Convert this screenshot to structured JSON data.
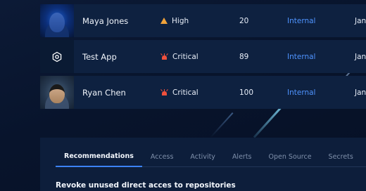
{
  "rows": [
    {
      "name": "Maya Jones",
      "severity": "High",
      "count": "20",
      "scope": "Internal",
      "date": "Jan",
      "thumb": "avatar-photo"
    },
    {
      "name": "Test App",
      "severity": "Critical",
      "count": "89",
      "scope": "Internal",
      "date": "Jan",
      "thumb": "hexagon-app-icon"
    },
    {
      "name": "Ryan Chen",
      "severity": "Critical",
      "count": "100",
      "scope": "Internal",
      "date": "Jan",
      "thumb": "avatar-photo"
    }
  ],
  "colors": {
    "high": "#f1a33a",
    "critical": "#f0503c",
    "link": "#4f94ff",
    "accent": "#3b82f6"
  },
  "tabs": [
    {
      "label": "Recommendations",
      "active": true
    },
    {
      "label": "Access",
      "active": false
    },
    {
      "label": "Activity",
      "active": false
    },
    {
      "label": "Alerts",
      "active": false
    },
    {
      "label": "Open Source",
      "active": false
    },
    {
      "label": "Secrets",
      "active": false
    }
  ],
  "recommendation": {
    "title": "Revoke unused direct acces to repositories"
  }
}
